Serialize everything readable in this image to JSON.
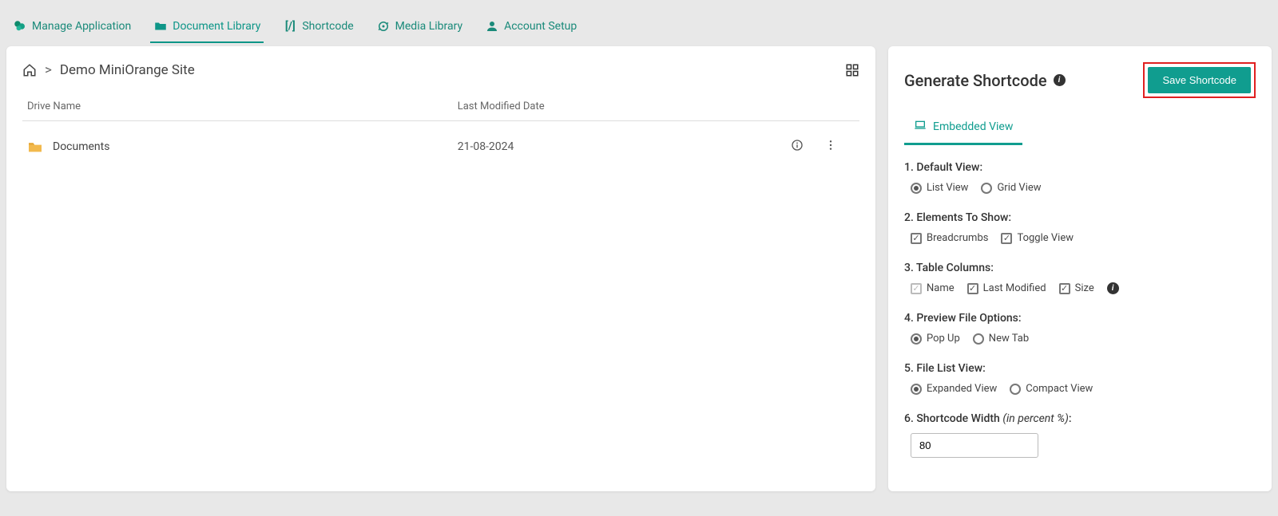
{
  "tabs": {
    "manage": "Manage Application",
    "doclib": "Document Library",
    "shortcode": "Shortcode",
    "media": "Media Library",
    "account": "Account Setup"
  },
  "breadcrumb": {
    "sep": ">",
    "site": "Demo MiniOrange Site"
  },
  "columns": {
    "name": "Drive Name",
    "date": "Last Modified Date"
  },
  "rows": [
    {
      "name": "Documents",
      "date": "21-08-2024"
    }
  ],
  "right": {
    "title": "Generate Shortcode",
    "save": "Save Shortcode",
    "viewTab": "Embedded View",
    "s1": {
      "label": "1. Default View:",
      "opt1": "List View",
      "opt2": "Grid View"
    },
    "s2": {
      "label": "2. Elements To Show:",
      "opt1": "Breadcrumbs",
      "opt2": "Toggle View"
    },
    "s3": {
      "label": "3. Table Columns:",
      "opt1": "Name",
      "opt2": "Last Modified",
      "opt3": "Size"
    },
    "s4": {
      "label": "4. Preview File Options:",
      "opt1": "Pop Up",
      "opt2": "New Tab"
    },
    "s5": {
      "label": "5. File List View:",
      "opt1": "Expanded View",
      "opt2": "Compact View"
    },
    "s6": {
      "label": "6. Shortcode Width ",
      "hint": "(in percent %)",
      "colon": ":",
      "value": "80"
    }
  }
}
